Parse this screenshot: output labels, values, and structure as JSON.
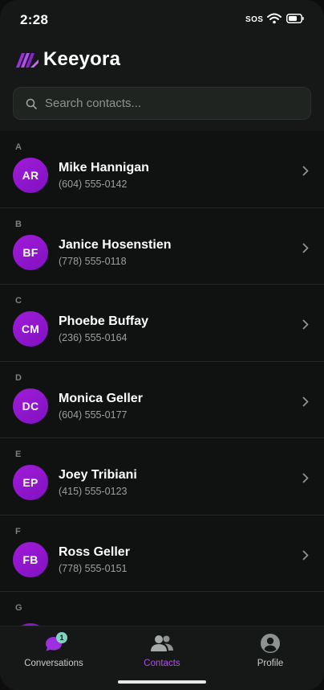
{
  "status_bar": {
    "time": "2:28",
    "carrier": "SOS"
  },
  "header": {
    "brand": "Keeyora"
  },
  "search": {
    "placeholder": "Search contacts..."
  },
  "contacts": [
    {
      "section": "A",
      "initials": "AR",
      "name": "Mike Hannigan",
      "phone": "(604) 555-0142"
    },
    {
      "section": "B",
      "initials": "BF",
      "name": "Janice Hosenstien",
      "phone": "(778) 555-0118"
    },
    {
      "section": "C",
      "initials": "CM",
      "name": "Phoebe Buffay",
      "phone": "(236) 555-0164"
    },
    {
      "section": "D",
      "initials": "DC",
      "name": "Monica Geller",
      "phone": "(604) 555-0177"
    },
    {
      "section": "E",
      "initials": "EP",
      "name": "Joey Tribiani",
      "phone": "(415) 555-0123"
    },
    {
      "section": "F",
      "initials": "FB",
      "name": "Ross Geller",
      "phone": "(778) 555-0151"
    }
  ],
  "next_section": "G",
  "tabs": {
    "conversations": {
      "label": "Conversations",
      "badge": "1"
    },
    "contacts": {
      "label": "Contacts"
    },
    "profile": {
      "label": "Profile"
    }
  },
  "colors": {
    "accent": "#b34ee8",
    "avatar": "#9a18d4",
    "badge": "#7fd4c1"
  },
  "icons": [
    "wifi-icon",
    "battery-icon",
    "keeyora-logo",
    "search-icon",
    "chevron-right-icon",
    "chat-bubble-icon",
    "people-icon",
    "person-circle-icon"
  ]
}
